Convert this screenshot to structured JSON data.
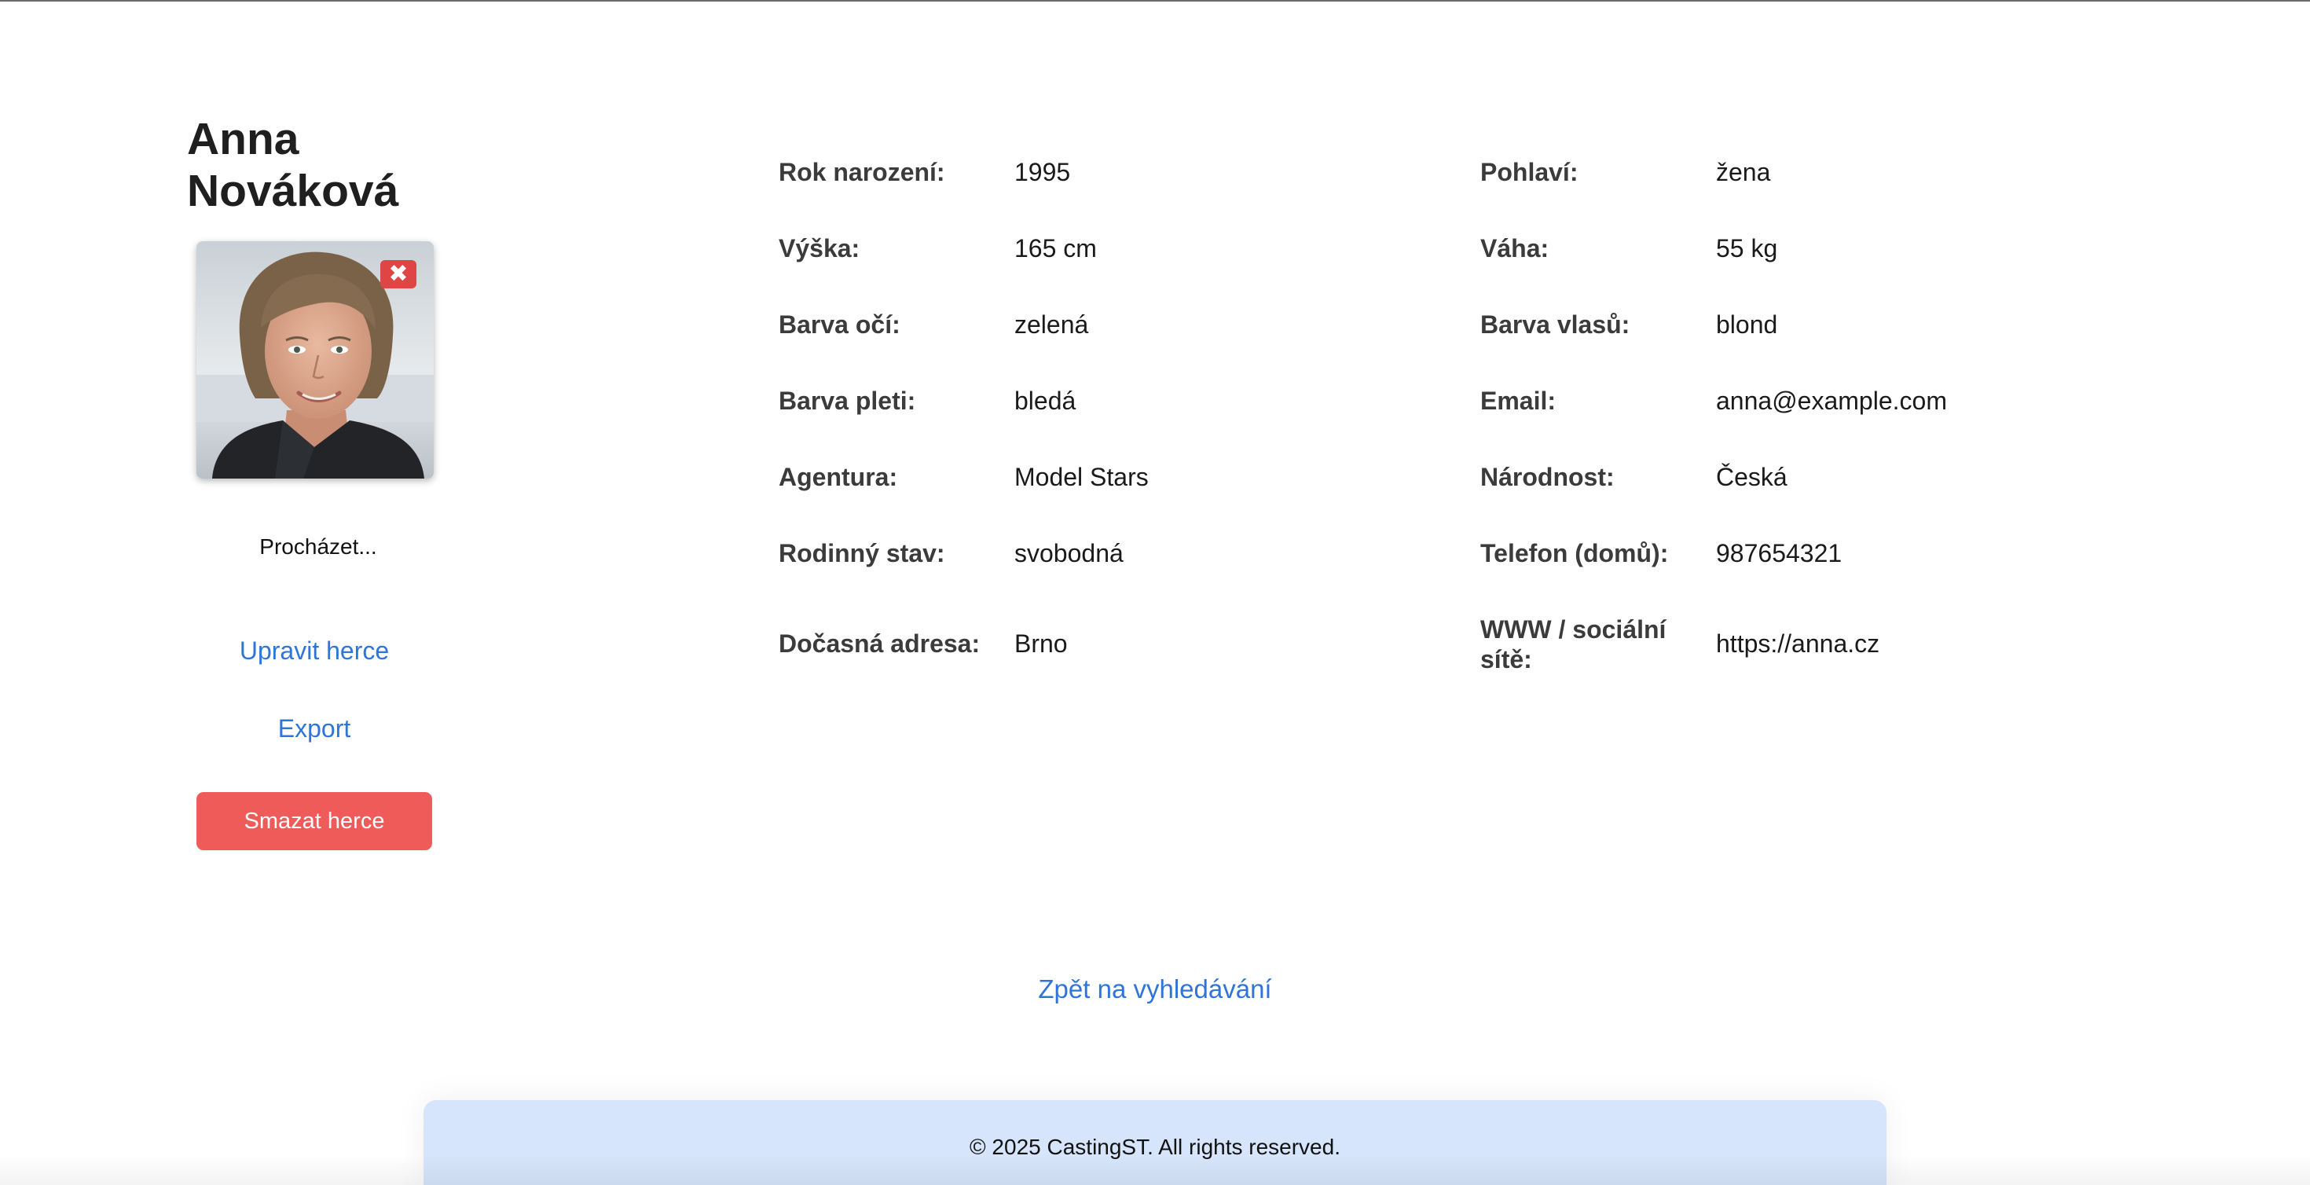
{
  "actor": {
    "name_line1": "Anna",
    "name_line2": "Nováková",
    "photo_remove_icon": "✖",
    "photo_alt": "Anna Nováková"
  },
  "photo_upload": {
    "browse_label": "Procházet..."
  },
  "actions": {
    "edit_label": "Upravit herce",
    "export_label": "Export",
    "delete_label": "Smazat herce"
  },
  "details": {
    "left": [
      {
        "label": "Rok narození:",
        "value": "1995"
      },
      {
        "label": "Výška:",
        "value": "165 cm"
      },
      {
        "label": "Barva očí:",
        "value": "zelená"
      },
      {
        "label": "Barva pleti:",
        "value": "bledá"
      },
      {
        "label": "Agentura:",
        "value": "Model Stars"
      },
      {
        "label": "Rodinný stav:",
        "value": "svobodná"
      },
      {
        "label": "Dočasná adresa:",
        "value": "Brno"
      }
    ],
    "right": [
      {
        "label": "Pohlaví:",
        "value": "žena"
      },
      {
        "label": "Váha:",
        "value": "55 kg"
      },
      {
        "label": "Barva vlasů:",
        "value": "blond"
      },
      {
        "label": "Email:",
        "value": "anna@example.com"
      },
      {
        "label": "Národnost:",
        "value": "Česká"
      },
      {
        "label": "Telefon (domů):",
        "value": "987654321"
      },
      {
        "label": "WWW / sociální sítě:",
        "value": "https://anna.cz"
      }
    ]
  },
  "navigation": {
    "back_label": "Zpět na vyhledávání"
  },
  "footer": {
    "text": "© 2025 CastingST. All rights reserved."
  },
  "colors": {
    "link": "#2f74d8",
    "delete_button": "#ef5b58",
    "remove_badge": "#e04545",
    "footer_bg": "#d6e5fb"
  }
}
